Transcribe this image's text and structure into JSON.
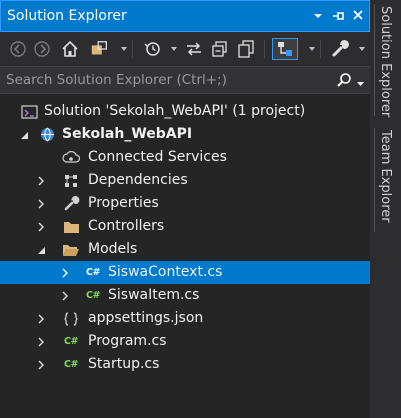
{
  "window": {
    "title": "Solution Explorer",
    "dropdown_icon": "chevron-down-icon",
    "pin_icon": "pin-icon",
    "close_icon": "close-icon"
  },
  "toolbar": {
    "icons": [
      "back-icon",
      "forward-icon",
      "home-icon",
      "switch-views-icon",
      "history-icon",
      "sync-icon",
      "collapse-all-icon",
      "show-all-files-icon",
      "preview-selected-icon",
      "properties-wrench-icon"
    ]
  },
  "search": {
    "placeholder": "Search Solution Explorer (Ctrl+;)"
  },
  "tree": {
    "solution": "Solution 'Sekolah_WebAPI' (1 project)",
    "project": "Sekolah_WebAPI",
    "connected_services": "Connected Services",
    "dependencies": "Dependencies",
    "properties": "Properties",
    "controllers": "Controllers",
    "models": "Models",
    "siswa_context": "SiswaContext.cs",
    "siswa_item": "SiswaItem.cs",
    "appsettings": "appsettings.json",
    "program": "Program.cs",
    "startup": "Startup.cs",
    "cs_badge": "C#"
  },
  "side_tabs": {
    "solution_explorer": "Solution Explorer",
    "team_explorer": "Team Explorer"
  },
  "colors": {
    "accent": "#007acc",
    "background": "#252526",
    "folder": "#dcb67a",
    "csharp": "#7ed957"
  }
}
